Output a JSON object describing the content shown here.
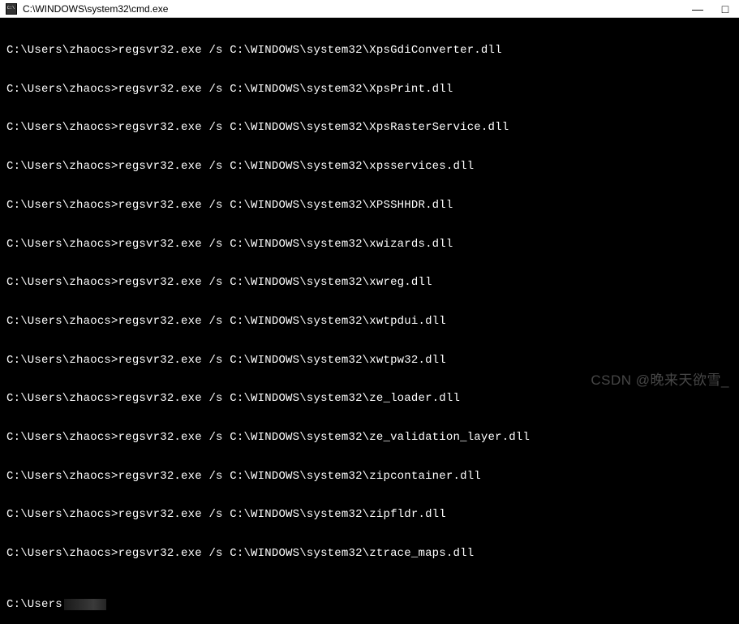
{
  "window": {
    "title": "C:\\WINDOWS\\system32\\cmd.exe",
    "minimize": "—",
    "maximize": "□"
  },
  "terminal": {
    "prompt": "C:\\Users\\zhaocs>",
    "final_prompt": "C:\\Users",
    "command_prefix": "regsvr32.exe /s C:\\WINDOWS\\system32\\",
    "lines": [
      "regsvr32.exe /s C:\\WINDOWS\\system32\\XpsGdiConverter.dll",
      "regsvr32.exe /s C:\\WINDOWS\\system32\\XpsPrint.dll",
      "regsvr32.exe /s C:\\WINDOWS\\system32\\XpsRasterService.dll",
      "regsvr32.exe /s C:\\WINDOWS\\system32\\xpsservices.dll",
      "regsvr32.exe /s C:\\WINDOWS\\system32\\XPSSHHDR.dll",
      "regsvr32.exe /s C:\\WINDOWS\\system32\\xwizards.dll",
      "regsvr32.exe /s C:\\WINDOWS\\system32\\xwreg.dll",
      "regsvr32.exe /s C:\\WINDOWS\\system32\\xwtpdui.dll",
      "regsvr32.exe /s C:\\WINDOWS\\system32\\xwtpw32.dll",
      "regsvr32.exe /s C:\\WINDOWS\\system32\\ze_loader.dll",
      "regsvr32.exe /s C:\\WINDOWS\\system32\\ze_validation_layer.dll",
      "regsvr32.exe /s C:\\WINDOWS\\system32\\zipcontainer.dll",
      "regsvr32.exe /s C:\\WINDOWS\\system32\\zipfldr.dll",
      "regsvr32.exe /s C:\\WINDOWS\\system32\\ztrace_maps.dll"
    ]
  },
  "watermark": "CSDN @晚来天欲雪_"
}
